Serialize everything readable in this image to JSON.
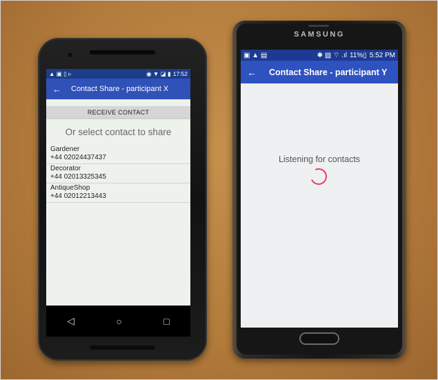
{
  "phone_x": {
    "status": {
      "icons_left": "▲ ▣ ▯ ▹",
      "icons_right": "◉ ▼ ◪ ▮",
      "time": "17:52"
    },
    "appbar": {
      "back_icon": "←",
      "title": "Contact Share - participant X"
    },
    "receive_button": "RECEIVE CONTACT",
    "select_text": "Or select contact to share",
    "contacts": [
      {
        "name": "Gardener",
        "phone": "+44 02024437437"
      },
      {
        "name": "Decorator",
        "phone": "+44 02013325345"
      },
      {
        "name": "AntiqueShop",
        "phone": "+44 02012213443"
      }
    ],
    "nav": {
      "back": "◁",
      "home": "○",
      "recents": "□"
    }
  },
  "phone_y": {
    "brand": "SAMSUNG",
    "status": {
      "icons_left": "▣ ▲ ▤",
      "icons_right": "✱ ▧ ⌔ .ıl",
      "battery": "11%▯",
      "time": "5:52 PM"
    },
    "appbar": {
      "back_icon": "←",
      "title": "Contact Share - participant Y"
    },
    "listening_text": "Listening for contacts",
    "spinner_color": "#ef3a5a"
  },
  "colors": {
    "appbar_x": "#2f51b8",
    "appbar_y": "#2e52c0",
    "status_bar": "#1c3d8c"
  }
}
